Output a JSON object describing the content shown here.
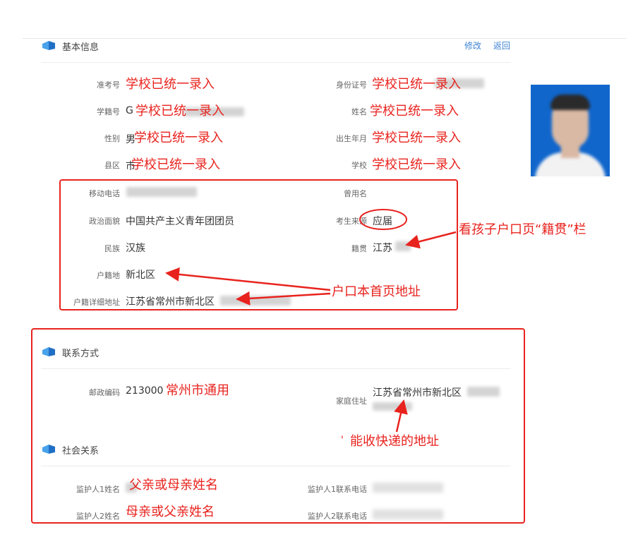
{
  "header": {
    "basic_title": "基本信息",
    "edit_label": "修改",
    "back_label": "返回"
  },
  "basic": {
    "exam_no_label": "准考号",
    "exam_no_note": "学校已统一录入",
    "id_label": "身份证号",
    "id_note": "学校已统一录入",
    "student_no_label": "学籍号",
    "student_no_prefix": "G",
    "student_no_note": "学校已统一录入",
    "name_label": "姓名",
    "name_note": "学校已统一录入",
    "gender_label": "性别",
    "gender_value": "男",
    "gender_note": "学校已统一录入",
    "birth_label": "出生年月",
    "birth_note": "学校已统一录入",
    "county_label": "县区",
    "county_prefix": "市",
    "county_note": "学校已统一录入",
    "school_label": "学校",
    "school_note": "学校已统一录入"
  },
  "personal": {
    "mobile_label": "移动电话",
    "alias_label": "曾用名",
    "politics_label": "政治面貌",
    "politics_value": "中国共产主义青年团团员",
    "source_label": "考生来源",
    "source_value": "应届",
    "ethnic_label": "民族",
    "ethnic_value": "汉族",
    "native_label": "籍贯",
    "native_value": "江苏",
    "hukou_label": "户籍地",
    "hukou_value": "新北区",
    "hukou_addr_label": "户籍详细地址",
    "hukou_addr_value": "江苏省常州市新北区"
  },
  "contact": {
    "title": "联系方式",
    "zip_label": "邮政编码",
    "zip_value": "213000",
    "zip_note": "常州市通用",
    "home_label": "家庭住址",
    "home_value": "江苏省常州市新北区"
  },
  "social": {
    "title": "社会关系",
    "g1_name_label": "监护人1姓名",
    "g1_name_note": "父亲或母亲姓名",
    "g1_phone_label": "监护人1联系电话",
    "g2_name_label": "监护人2姓名",
    "g2_name_note": "母亲或父亲姓名",
    "g2_phone_label": "监护人2联系电话"
  },
  "annotations": {
    "native_note": "看孩子户口页“籍贯”栏",
    "hukou_note": "户口本首页地址",
    "address_note": "能收快递的地址",
    "address_dot": "'"
  },
  "colors": {
    "annotation_red": "#e8231e",
    "link_blue": "#3f84d4",
    "photo_bg": "#1166cc"
  }
}
